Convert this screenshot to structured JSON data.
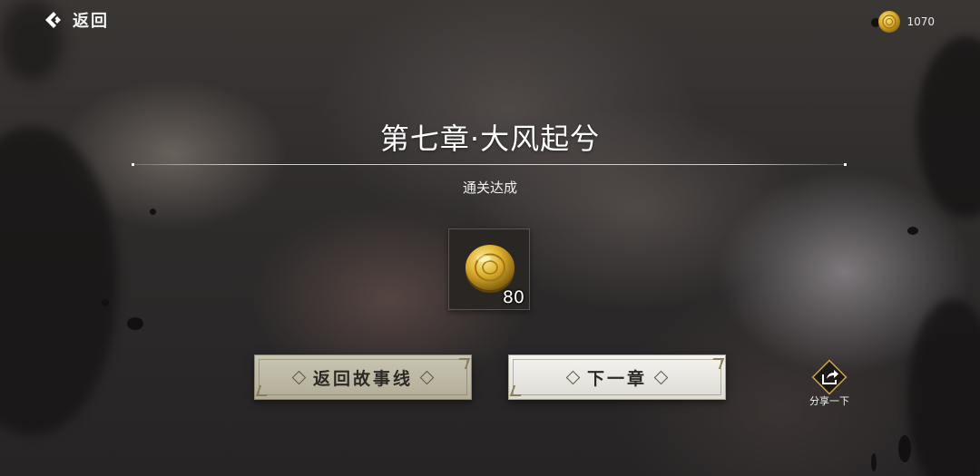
{
  "nav": {
    "back_label": "返回"
  },
  "currency": {
    "icon": "gold-coin-icon",
    "amount": "1070"
  },
  "chapter": {
    "title": "第七章·大风起兮",
    "status": "通关达成"
  },
  "reward": {
    "icon": "gold-coin-icon",
    "count": "80"
  },
  "buttons": {
    "back_to_story": "返回故事线",
    "next_chapter": "下一章"
  },
  "share": {
    "icon": "share-icon",
    "label": "分享一下"
  },
  "colors": {
    "gold": "#d9a928",
    "button_light": "#f4f3ef",
    "button_tan": "#c9c5b4"
  }
}
